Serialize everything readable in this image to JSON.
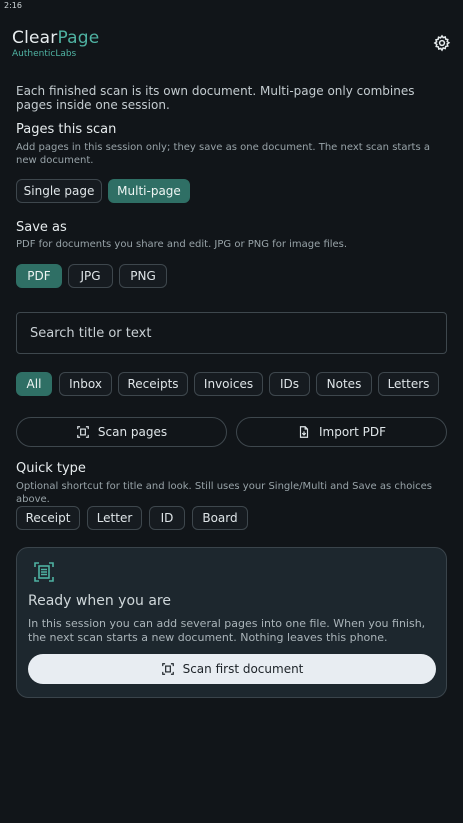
{
  "status_bar": {
    "time": "2:16"
  },
  "brand": {
    "title_part1": "Clear",
    "title_part2": "Page",
    "subtitle": "AuthenticLabs"
  },
  "intro": "Each finished scan is its own document. Multi-page only combines pages inside one session.",
  "pages": {
    "heading": "Pages this scan",
    "description": "Add pages in this session only; they save as one document. The next scan starts a new document.",
    "options": [
      "Single page",
      "Multi-page"
    ],
    "selected": "Multi-page"
  },
  "save_as": {
    "heading": "Save as",
    "description": "PDF for documents you share and edit. JPG or PNG for image files.",
    "options": [
      "PDF",
      "JPG",
      "PNG"
    ],
    "selected": "PDF"
  },
  "search": {
    "placeholder": "Search title or text"
  },
  "filters": {
    "items": [
      "All",
      "Inbox",
      "Receipts",
      "Invoices",
      "IDs",
      "Notes",
      "Letters"
    ],
    "selected": "All"
  },
  "actions": {
    "scan_label": "Scan pages",
    "import_label": "Import PDF"
  },
  "quick_type": {
    "heading": "Quick type",
    "description": "Optional shortcut for title and look. Still uses your Single/Multi and Save as choices above.",
    "options": [
      "Receipt",
      "Letter",
      "ID",
      "Board"
    ]
  },
  "empty_card": {
    "title": "Ready when you are",
    "text": "In this session you can add several pages into one file. When you finish, the next scan starts a new document. Nothing leaves this phone.",
    "button_label": "Scan first document"
  },
  "colors": {
    "accent": "#4fb2a2",
    "selected_chip": "#2f6f65",
    "background": "#111519",
    "card": "#1d272e"
  },
  "icons": [
    "gear-icon",
    "scan-icon",
    "import-pdf-icon",
    "document-scan-icon"
  ]
}
